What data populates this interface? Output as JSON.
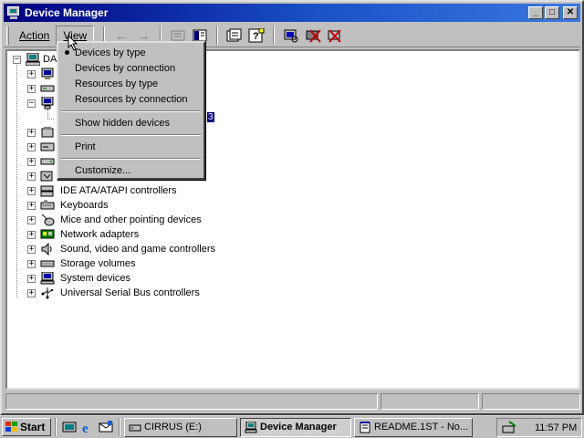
{
  "window": {
    "title": "Device Manager"
  },
  "title_buttons": {
    "minimize": "_",
    "maximize": "□",
    "close": "✕"
  },
  "menu": {
    "action": "Action",
    "view": "View"
  },
  "toolbar_icons": [
    "back-arrow-icon",
    "forward-arrow-icon",
    "tree-view-icon",
    "properties-icon",
    "refresh-icon",
    "help-icon",
    "scan-icon",
    "uninstall-icon",
    "disable-icon"
  ],
  "view_menu": {
    "items": [
      {
        "label": "Devices by type",
        "checked": true
      },
      {
        "label": "Devices by connection",
        "checked": false
      },
      {
        "label": "Resources by type",
        "checked": false
      },
      {
        "label": "Resources by connection",
        "checked": false
      },
      {
        "label": "Show hidden devices",
        "checked": false
      },
      {
        "label": "Print",
        "checked": false
      },
      {
        "label": "Customize...",
        "checked": false
      }
    ]
  },
  "tree": {
    "root_label_fragment": "DA",
    "selected_fragment": "3",
    "visible_categories": [
      "IDE ATA/ATAPI controllers",
      "Keyboards",
      "Mice and other pointing devices",
      "Network adapters",
      "Sound, video and game controllers",
      "Storage volumes",
      "System devices",
      "Universal Serial Bus controllers"
    ]
  },
  "taskbar": {
    "start": "Start",
    "tasks": [
      {
        "label": "CIRRUS (E:)",
        "active": false
      },
      {
        "label": "Device Manager",
        "active": true
      },
      {
        "label": "README.1ST - No...",
        "active": false
      }
    ],
    "clock": "11:57 PM"
  }
}
